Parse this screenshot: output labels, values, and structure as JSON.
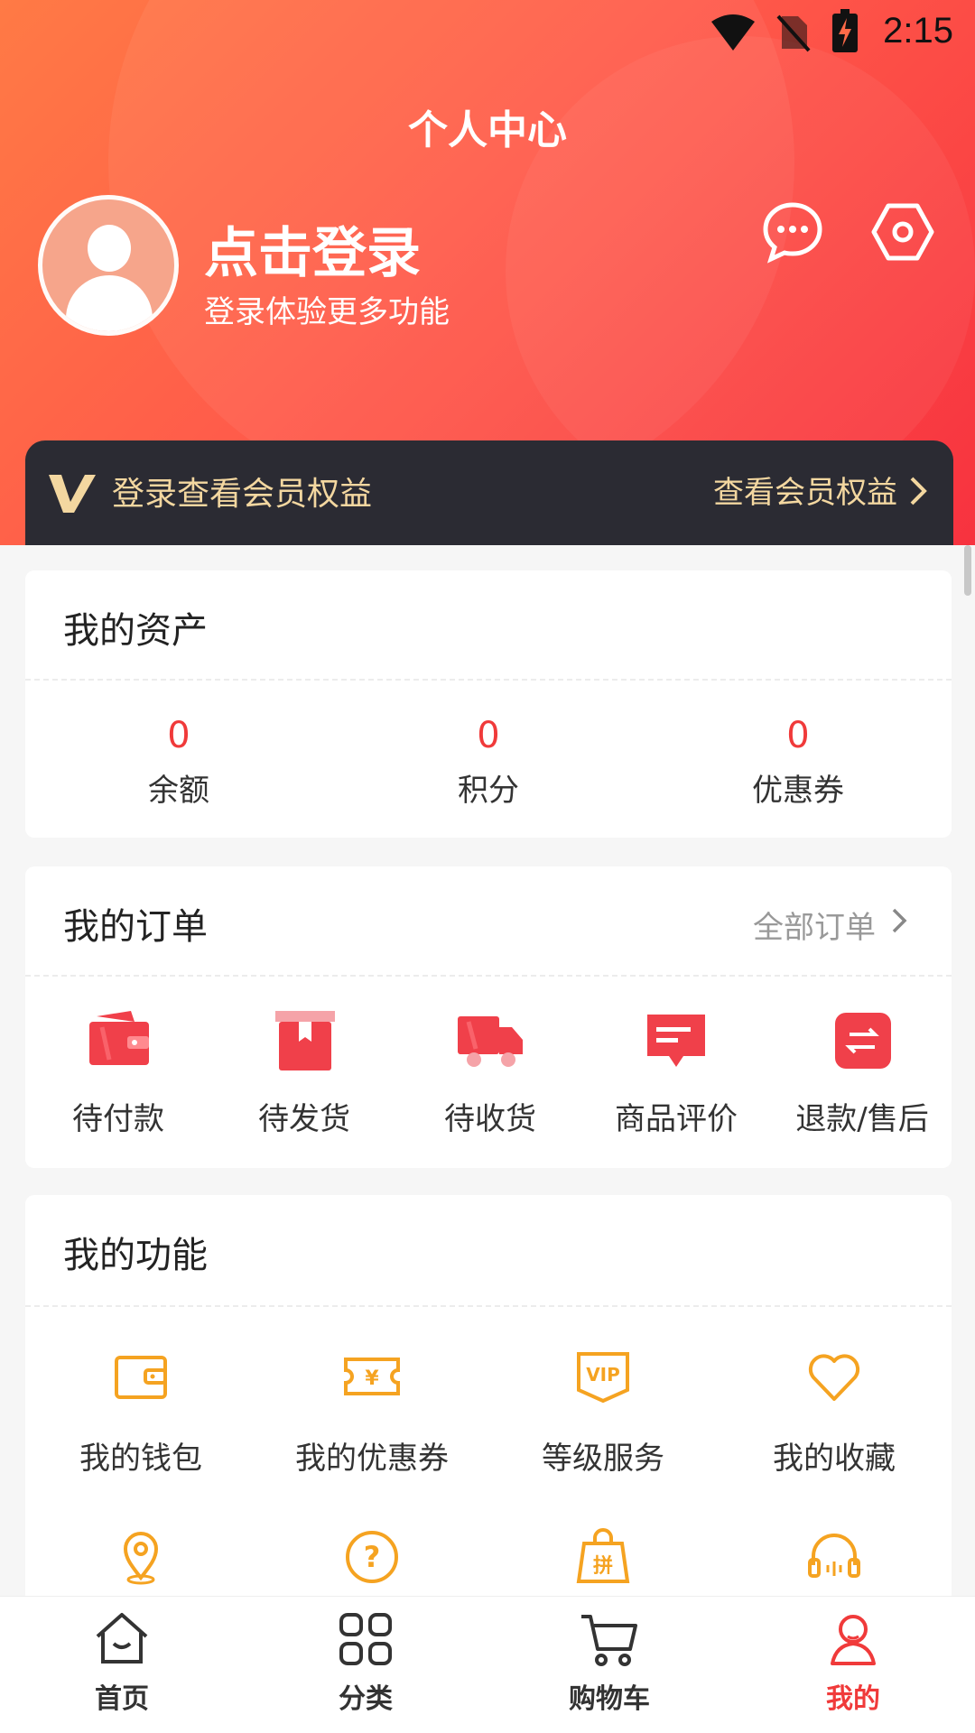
{
  "status_bar": {
    "time": "2:15"
  },
  "header": {
    "title": "个人中心",
    "login_title": "点击登录",
    "login_subtitle": "登录体验更多功能",
    "icons": [
      "message-icon",
      "settings-icon"
    ]
  },
  "vip_banner": {
    "left_text": "登录查看会员权益",
    "right_text": "查看会员权益"
  },
  "assets": {
    "title": "我的资产",
    "items": [
      {
        "value": "0",
        "label": "余额"
      },
      {
        "value": "0",
        "label": "积分"
      },
      {
        "value": "0",
        "label": "优惠券"
      }
    ]
  },
  "orders": {
    "title": "我的订单",
    "all_label": "全部订单",
    "items": [
      {
        "label": "待付款",
        "icon": "wallet-icon"
      },
      {
        "label": "待发货",
        "icon": "package-icon"
      },
      {
        "label": "待收货",
        "icon": "truck-icon"
      },
      {
        "label": "商品评价",
        "icon": "review-icon"
      },
      {
        "label": "退款/售后",
        "icon": "refund-icon"
      }
    ]
  },
  "functions": {
    "title": "我的功能",
    "items": [
      {
        "label": "我的钱包",
        "icon": "wallet-outline-icon"
      },
      {
        "label": "我的优惠券",
        "icon": "coupon-icon"
      },
      {
        "label": "等级服务",
        "icon": "vip-icon"
      },
      {
        "label": "我的收藏",
        "icon": "heart-icon"
      },
      {
        "icon": "location-icon"
      },
      {
        "icon": "help-icon"
      },
      {
        "icon": "group-buy-icon"
      },
      {
        "icon": "customer-service-icon"
      }
    ]
  },
  "tabbar": {
    "items": [
      {
        "label": "首页",
        "icon": "home-icon"
      },
      {
        "label": "分类",
        "icon": "category-icon"
      },
      {
        "label": "购物车",
        "icon": "cart-icon"
      },
      {
        "label": "我的",
        "icon": "profile-icon",
        "active": true
      }
    ]
  },
  "colors": {
    "accent_red": "#f03a3a",
    "header_gradient_start": "#ff7a45",
    "header_gradient_end": "#f7323f",
    "vip_bar": "#2b2b33",
    "vip_text": "#f3d7a0",
    "function_orange": "#f5a321"
  }
}
